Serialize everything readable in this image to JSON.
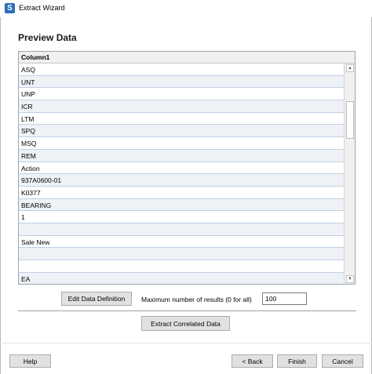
{
  "window": {
    "title": "Extract Wizard",
    "icon": "S"
  },
  "section_title": "Preview Data",
  "grid": {
    "column_header": "Column1",
    "rows": [
      "ASQ",
      "UNT",
      "UNP",
      "ICR",
      "LTM",
      "SPQ",
      "MSQ",
      "REM",
      "Action",
      "937A0600-01",
      "K0377",
      "BEARING",
      "1",
      "",
      "Sale New",
      "",
      "",
      "EA"
    ]
  },
  "scrollbar": {
    "up": "▲",
    "down": "▼"
  },
  "controls": {
    "edit_label": "Edit Data Definition",
    "max_label": "Maximum number of results (0 for all)",
    "max_value": "100",
    "extract_label": "Extract Correlated Data"
  },
  "footer": {
    "help_label": "Help",
    "back_label": "< Back",
    "finish_label": "Finish",
    "cancel_label": "Cancel"
  }
}
